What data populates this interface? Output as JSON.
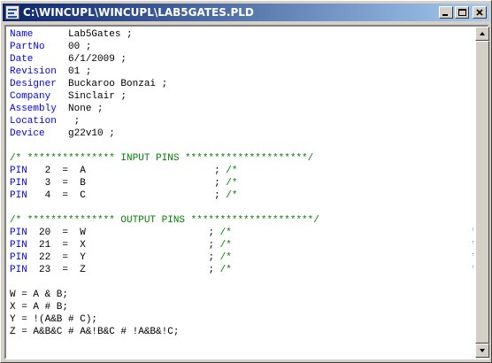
{
  "window": {
    "title": "C:\\WINCUPL\\WINCUPL\\LAB5GATES.PLD"
  },
  "icons": {
    "app": "wincupl-app-icon",
    "minimize": "minimize-icon",
    "maximize": "maximize-icon",
    "close": "close-icon",
    "scroll_up": "scroll-up-arrow-icon",
    "scroll_down": "scroll-down-arrow-icon"
  },
  "colors": {
    "keyword": "#0000ff",
    "comment": "#008000",
    "text": "#000000",
    "titlebar_start": "#0a246a",
    "titlebar_end": "#a6caf0"
  },
  "header_fields": [
    {
      "key": "Name",
      "value": "Lab5Gates ;"
    },
    {
      "key": "PartNo",
      "value": "00 ;"
    },
    {
      "key": "Date",
      "value": "6/1/2009 ;"
    },
    {
      "key": "Revision",
      "value": "01 ;"
    },
    {
      "key": "Designer",
      "value": "Buckaroo Bonzai ;"
    },
    {
      "key": "Company",
      "value": "Sinclair ;"
    },
    {
      "key": "Assembly",
      "value": "None ;"
    },
    {
      "key": "Location",
      "value": " ;"
    },
    {
      "key": "Device",
      "value": "g22v10 ;"
    }
  ],
  "input_section": {
    "banner": "/* *************** INPUT PINS *********************/",
    "pins": [
      {
        "keyword": "PIN",
        "number": "2",
        "name": "A",
        "comment_open": "/*",
        "comment_close": "*/"
      },
      {
        "keyword": "PIN",
        "number": "3",
        "name": "B",
        "comment_open": "/*",
        "comment_close": "*/"
      },
      {
        "keyword": "PIN",
        "number": "4",
        "name": "C",
        "comment_open": "/*",
        "comment_close": "*/"
      }
    ]
  },
  "output_section": {
    "banner": "/* *************** OUTPUT PINS *********************/",
    "pins": [
      {
        "keyword": "PIN",
        "number": "20",
        "name": "W",
        "comment_open": "/*",
        "comment_close": "*/"
      },
      {
        "keyword": "PIN",
        "number": "21",
        "name": "X",
        "comment_open": "/*",
        "comment_close": "*/"
      },
      {
        "keyword": "PIN",
        "number": "22",
        "name": "Y",
        "comment_open": "/*",
        "comment_close": "*/"
      },
      {
        "keyword": "PIN",
        "number": "23",
        "name": "Z",
        "comment_open": "/*",
        "comment_close": "*/"
      }
    ]
  },
  "equations": [
    "W = A & B;",
    "X = A # B;",
    "Y = !(A&B # C);",
    "Z = A&B&C # A&!B&C # !A&B&!C;"
  ]
}
